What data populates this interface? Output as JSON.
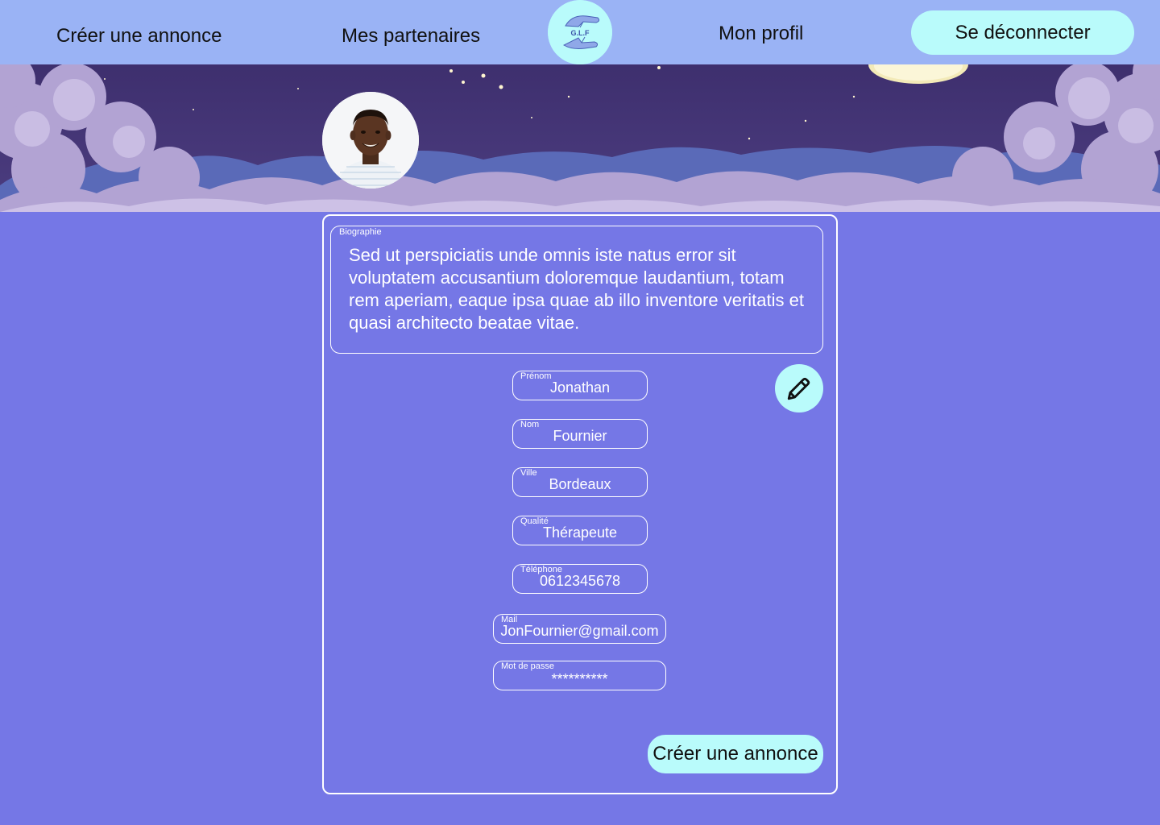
{
  "nav": {
    "create_ad": "Créer une annonce",
    "partners": "Mes partenaires",
    "profile": "Mon profil",
    "logout": "Se déconnecter",
    "logo_text": "G.L.F"
  },
  "profile": {
    "bio": {
      "label": "Biographie",
      "text": "Sed ut perspiciatis unde omnis iste natus error sit voluptatem accusantium doloremque laudantium, totam rem aperiam, eaque ipsa quae ab illo inventore veritatis et quasi architecto beatae vitae."
    },
    "fields": {
      "first_name": {
        "label": "Prénom",
        "value": "Jonathan"
      },
      "last_name": {
        "label": "Nom",
        "value": "Fournier"
      },
      "city": {
        "label": "Ville",
        "value": "Bordeaux"
      },
      "role": {
        "label": "Qualité",
        "value": "Thérapeute"
      },
      "phone": {
        "label": "Téléphone",
        "value": "0612345678"
      },
      "email": {
        "label": "Mail",
        "value": "JonFournier@gmail.com"
      },
      "password": {
        "label": "Mot de passe",
        "value": "**********"
      }
    },
    "create_button": "Créer une annonce",
    "edit_icon": "pencil-icon"
  },
  "colors": {
    "nav_bg": "#9ab3f5",
    "page_bg": "#7577e6",
    "accent": "#b9fbfb",
    "night_sky": "#4a3a7c",
    "cloud": "#b2a3d3"
  }
}
